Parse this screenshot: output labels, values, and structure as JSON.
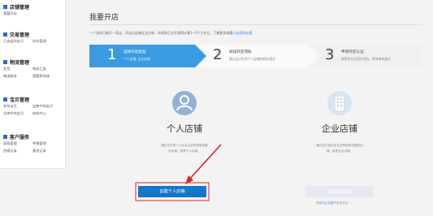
{
  "sidebar": [
    {
      "title": "店铺管理",
      "icon_color": "#2d6cc8",
      "links": [
        "我要开店"
      ]
    },
    {
      "title": "交易管理",
      "icon_color": "#2d6cc8",
      "links": [
        "已卖出的宝贝",
        "评价管理"
      ]
    },
    {
      "title": "物流管理",
      "icon_color": "#2d6cc8",
      "links": [
        "发货",
        "物流工具",
        "物流服务",
        "我要寄快递"
      ]
    },
    {
      "title": "宝贝管理",
      "icon_color": "#2d6cc8",
      "links": [
        "发布宝贝",
        "出售中的宝贝",
        "仓库中的宝贝",
        "体检中心"
      ]
    },
    {
      "title": "客户服务",
      "icon_color": "#2d6cc8",
      "links": [
        "退款管理",
        "举报管理",
        "违规记录",
        "基金记录"
      ]
    }
  ],
  "main": {
    "title": "我要开店",
    "notice_text": "一个身份只能开一家店，开店后店铺无法注销，申请到正式开通预计需1~3个工作日。了解更多请看",
    "notice_link": "开店规则必看"
  },
  "steps": [
    {
      "num": "1",
      "title": "选择开店类型",
      "sub": "个人店铺, 企业店铺",
      "active": true
    },
    {
      "num": "2",
      "title": "阅读开店须知",
      "sub": "确认自己符合个人店铺的相关规定",
      "active": false
    },
    {
      "num": "3",
      "title": "申请开店认证",
      "sub": "需提供认证相关资料，等待审核通过",
      "active": false
    }
  ],
  "cards": {
    "personal": {
      "title": "个人店铺",
      "desc1": "通过支付宝个人实名认证的商家创建",
      "desc2": "的店铺，就是个人店铺。",
      "button": "创建个人店铺"
    },
    "enterprise": {
      "title": "企业店铺",
      "desc1": "通过支付宝企业认证的商家创建的店",
      "desc2": "铺，就是企业店铺。",
      "button": "创建企业店铺",
      "note_pre": "请使用",
      "note_link": "企业账户",
      "note_post": "登录开店"
    }
  },
  "colors": {
    "accent": "#2d8cf0",
    "button": "#1476c8",
    "arrow": "#e02222"
  }
}
